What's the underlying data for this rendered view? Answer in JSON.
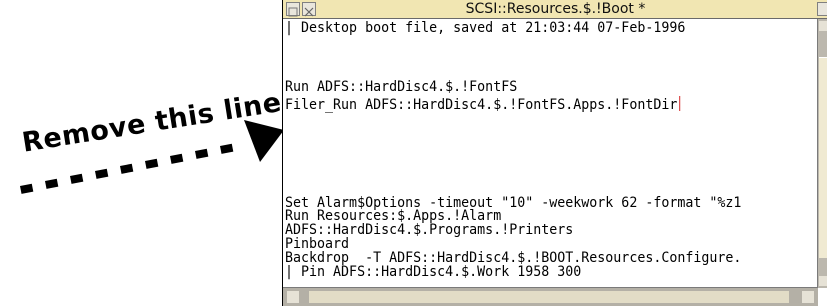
{
  "annotation": {
    "text": "Remove this line"
  },
  "window": {
    "title": "SCSI::Resources.$.!Boot *"
  },
  "editor": {
    "lines": [
      "| Desktop boot file, saved at 21:03:44 07-Feb-1996",
      "Run ADFS::HardDisc4.$.!FontFS",
      "Filer_Run ADFS::HardDisc4.$.!FontFS.Apps.!FontDir",
      "Set Alarm$Options -timeout \"10\" -weekwork 62 -format \"%z1",
      "Run Resources:$.Apps.!Alarm",
      "ADFS::HardDisc4.$.Programs.!Printers",
      "Pinboard",
      "Backdrop  -T ADFS::HardDisc4.$.!BOOT.Resources.Configure.",
      "| Pin ADFS::HardDisc4.$.Work 1958 300"
    ]
  }
}
